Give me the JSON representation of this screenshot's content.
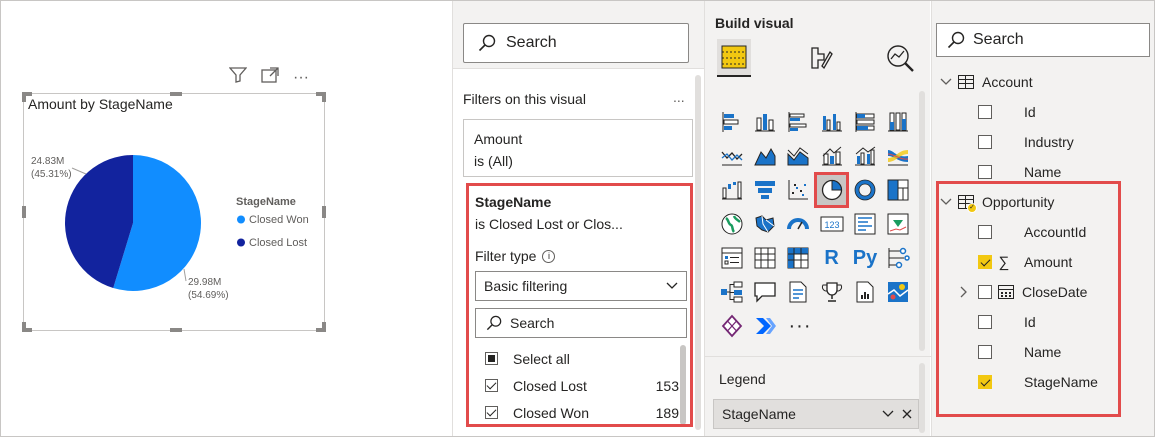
{
  "visual_toolbar": {
    "filter_icon": "filter-icon",
    "focus_icon": "focus-mode-icon",
    "more": "···"
  },
  "chart_data": {
    "type": "pie",
    "title": "Amount by StageName",
    "legend_title": "StageName",
    "legend_position": "right",
    "slices": [
      {
        "name": "Closed Won",
        "value": 29.98,
        "label": "29.98M",
        "pct": "(54.69%)",
        "percent": 54.69,
        "color": "#118dff"
      },
      {
        "name": "Closed Lost",
        "value": 24.83,
        "label": "24.83M",
        "pct": "(45.31%)",
        "percent": 45.31,
        "color": "#12239e"
      }
    ]
  },
  "filters": {
    "search_placeholder": "Search",
    "heading": "Filters on this visual",
    "more": "...",
    "amount_card": {
      "field": "Amount",
      "state": "is (All)"
    },
    "stage_card": {
      "field": "StageName",
      "state": "is Closed Lost or Clos...",
      "filter_type_label": "Filter type",
      "filter_type_value": "Basic filtering",
      "search_placeholder": "Search",
      "items": [
        {
          "label": "Select all",
          "count": "",
          "state": "partial"
        },
        {
          "label": "Closed Lost",
          "count": "153",
          "state": "checked"
        },
        {
          "label": "Closed Won",
          "count": "189",
          "state": "checked"
        }
      ]
    }
  },
  "build": {
    "title": "Build visual",
    "legend_label": "Legend",
    "legend_field": "StageName",
    "more_visuals": "···",
    "r_label": "R",
    "py_label": "Py",
    "card_label": "123"
  },
  "data": {
    "search_placeholder": "Search",
    "tables": [
      {
        "name": "Account",
        "fields": [
          {
            "name": "Id",
            "checked": false
          },
          {
            "name": "Industry",
            "checked": false
          },
          {
            "name": "Name",
            "checked": false
          }
        ]
      },
      {
        "name": "Opportunity",
        "fields": [
          {
            "name": "AccountId",
            "checked": false
          },
          {
            "name": "Amount",
            "checked": true,
            "sigma": "∑"
          },
          {
            "name": "CloseDate",
            "checked": false
          },
          {
            "name": "Id",
            "checked": false
          },
          {
            "name": "Name",
            "checked": false
          },
          {
            "name": "StageName",
            "checked": true
          }
        ]
      }
    ]
  },
  "colors": {
    "accent_red": "#e24b4b",
    "pbi_yellow": "#f2c811",
    "series_light": "#118dff",
    "series_dark": "#12239e"
  }
}
